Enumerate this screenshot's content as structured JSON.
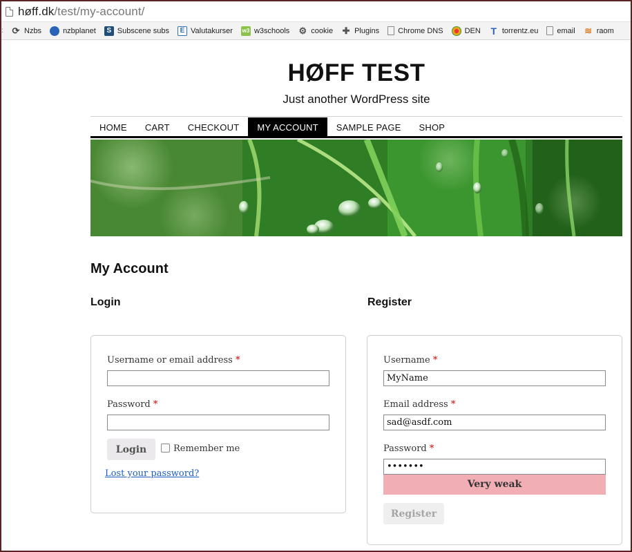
{
  "browser": {
    "url_host": "høff.dk",
    "url_path": "/test/my-account/",
    "bookmarks": [
      {
        "label": "Nzbs",
        "icon": "refresh-icon",
        "color": "#555555"
      },
      {
        "label": "nzbplanet",
        "icon": "planet-icon",
        "color": "#2a62b8"
      },
      {
        "label": "Subscene subs",
        "icon": "subscene-icon",
        "color": "#1f4e79"
      },
      {
        "label": "Valutakurser",
        "icon": "valuta-icon",
        "color": "#2d6fb5"
      },
      {
        "label": "w3schools",
        "icon": "w3schools-icon",
        "color": "#8bc34a"
      },
      {
        "label": "cookie",
        "icon": "gear-icon",
        "color": "#666666"
      },
      {
        "label": "Plugins",
        "icon": "puzzle-icon",
        "color": "#666666"
      },
      {
        "label": "Chrome DNS",
        "icon": "page-icon",
        "color": "#888888"
      },
      {
        "label": "DEN",
        "icon": "den-icon",
        "color": "#e8a317"
      },
      {
        "label": "torrentz.eu",
        "icon": "torrentz-icon",
        "color": "#2a62b8"
      },
      {
        "label": "email",
        "icon": "page-icon",
        "color": "#888888"
      },
      {
        "label": "raom",
        "icon": "raom-icon",
        "color": "#d9822b"
      }
    ]
  },
  "site": {
    "title": "HØFF TEST",
    "description": "Just another WordPress site"
  },
  "nav": {
    "items": [
      {
        "label": "HOME"
      },
      {
        "label": "CART"
      },
      {
        "label": "CHECKOUT"
      },
      {
        "label": "MY ACCOUNT",
        "active": true
      },
      {
        "label": "SAMPLE PAGE"
      },
      {
        "label": "SHOP"
      }
    ]
  },
  "page": {
    "heading": "My Account"
  },
  "login": {
    "heading": "Login",
    "username_label": "Username or email address",
    "username_value": "",
    "password_label": "Password",
    "password_value": "",
    "required_marker": "*",
    "submit_label": "Login",
    "remember_label": "Remember me",
    "remember_checked": false,
    "lost_password_label": "Lost your password?"
  },
  "register": {
    "heading": "Register",
    "username_label": "Username",
    "username_value": "MyName",
    "email_label": "Email address",
    "email_value": "sad@asdf.com",
    "password_label": "Password",
    "password_value": "•••••••",
    "required_marker": "*",
    "strength_label": "Very weak",
    "strength_color": "#f1aeb5",
    "submit_label": "Register",
    "submit_disabled": true
  }
}
